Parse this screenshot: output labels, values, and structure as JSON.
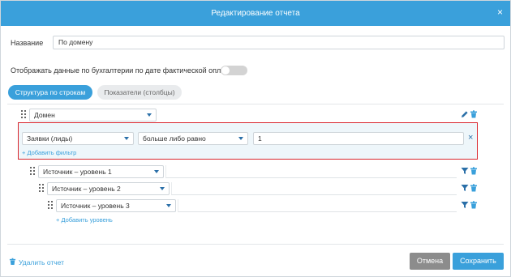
{
  "dialog": {
    "title": "Редактирование отчета",
    "close_label": "×"
  },
  "form": {
    "name_label": "Название",
    "name_value": "По домену",
    "accounting_label": "Отображать данные по бухгалтерии по дате фактической оплаты",
    "accounting_toggle_on": false
  },
  "tabs": [
    {
      "label": "Структура по строкам",
      "active": true
    },
    {
      "label": "Показатели (столбцы)",
      "active": false
    }
  ],
  "rows": {
    "main_select": "Домен",
    "filter": {
      "field": "Заявки (лиды)",
      "operator": "больше либо равно",
      "value": "1",
      "remove_label": "×",
      "add_label": "+ Добавить фильтр"
    },
    "levels": [
      {
        "label": "Источник – уровень 1"
      },
      {
        "label": "Источник – уровень 2"
      },
      {
        "label": "Источник – уровень 3"
      }
    ],
    "add_level_label": "+ Добавить уровень"
  },
  "footer": {
    "delete_label": "Удалить отчет",
    "cancel_label": "Отмена",
    "save_label": "Сохранить"
  },
  "colors": {
    "accent": "#3aa0db",
    "filter_border": "#d9252c",
    "cancel": "#8c8c8c"
  }
}
